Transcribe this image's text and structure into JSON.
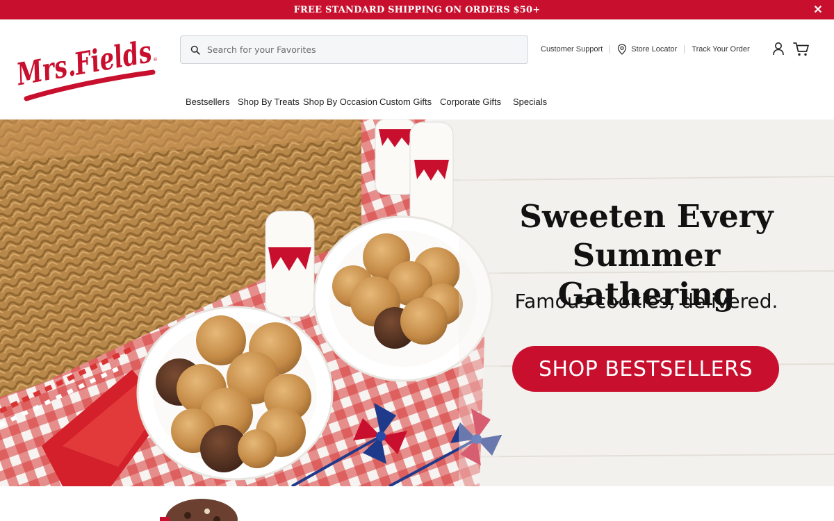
{
  "promo": {
    "text": "FREE STANDARD SHIPPING ON ORDERS $50+",
    "close_glyph": "✕"
  },
  "brand": {
    "logo_text": "Mrs.Fields",
    "logo_mark": "®",
    "color": "#c8102e"
  },
  "search": {
    "placeholder": "Search for your Favorites",
    "value": ""
  },
  "utility_links": {
    "support": "Customer Support",
    "store_locator": "Store Locator",
    "track_order": "Track Your Order"
  },
  "icons": {
    "search": "search-icon",
    "location": "map-pin-icon",
    "account": "user-icon",
    "cart": "shopping-cart-icon",
    "close": "close-icon"
  },
  "nav": {
    "items": [
      "Bestsellers",
      "Shop By Treats",
      "Shop By Occasion",
      "Custom Gifts",
      "Corporate Gifts",
      "Specials"
    ]
  },
  "hero": {
    "title_line1": "Sweeten Every",
    "title_line2": "Summer Gathering",
    "subtitle": "Famous cookies, delivered.",
    "cta": "SHOP BESTSELLERS"
  },
  "colors": {
    "accent": "#c8102e",
    "text": "#111111"
  }
}
